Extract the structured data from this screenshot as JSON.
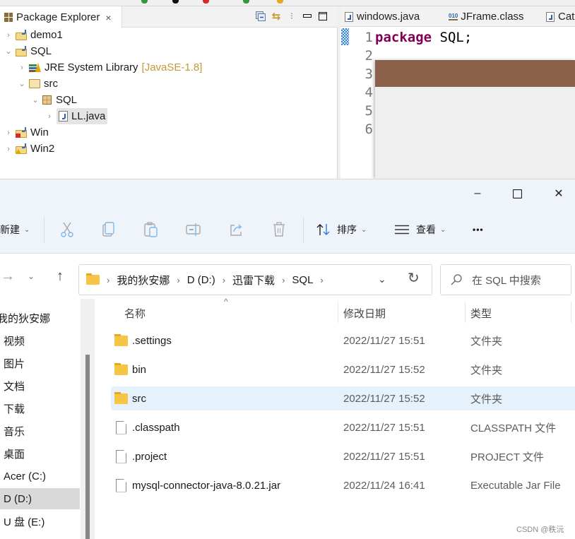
{
  "eclipse": {
    "package_explorer": {
      "tab_label": "Package Explorer",
      "close_glyph": "×",
      "tools": [
        {
          "name": "collapse-all-icon",
          "glyph": "⊟"
        },
        {
          "name": "link-with-editor-icon",
          "glyph": "⇆"
        },
        {
          "name": "view-menu-icon",
          "glyph": "⋮"
        },
        {
          "name": "minimize-icon",
          "glyph": "▭"
        },
        {
          "name": "maximize-icon",
          "glyph": "☐"
        }
      ],
      "tree": [
        {
          "label": "demo1",
          "expanded": false,
          "type": "project"
        },
        {
          "label": "SQL",
          "expanded": true,
          "type": "project"
        },
        {
          "label": "JRE System Library",
          "decoration": "[JavaSE-1.8]",
          "expanded": false,
          "type": "library"
        },
        {
          "label": "src",
          "expanded": true,
          "type": "source-folder"
        },
        {
          "label": "SQL",
          "expanded": true,
          "type": "package"
        },
        {
          "label": "LL.java",
          "expanded": false,
          "type": "java-file",
          "selected": true
        },
        {
          "label": "Win",
          "expanded": false,
          "type": "project-error"
        },
        {
          "label": "Win2",
          "expanded": false,
          "type": "project-warning"
        }
      ]
    },
    "editor": {
      "tabs": [
        {
          "label": "windows.java",
          "kind": "java"
        },
        {
          "label": "JFrame.class",
          "kind": "class"
        },
        {
          "label": "Cat",
          "kind": "java"
        }
      ],
      "line_numbers": [
        "1",
        "2",
        "3",
        "4",
        "5",
        "6"
      ],
      "code_keyword": "package",
      "code_rest": " SQL;"
    }
  },
  "explorer": {
    "window_controls": {
      "minimize": "–",
      "maximize": "☐",
      "close": "✕"
    },
    "command_bar": {
      "new_label": "新建",
      "sort_label": "排序",
      "view_label": "查看",
      "more_glyph": "•••",
      "chevron": "⌄",
      "actions": [
        "cut",
        "copy",
        "paste",
        "rename",
        "share",
        "delete"
      ]
    },
    "nav": {
      "back": "←",
      "forward": "→",
      "recent": "⌄",
      "up": "↑"
    },
    "address": {
      "breadcrumbs": [
        "我的狄安娜",
        "D (D:)",
        "迅雷下载",
        "SQL"
      ],
      "sep": "›",
      "dropdown": "⌄",
      "refresh": "↻"
    },
    "search": {
      "placeholder": "在 SQL 中搜索",
      "icon": "⚲"
    },
    "sidebar": {
      "items": [
        {
          "label": "我的狄安娜",
          "selected": false
        },
        {
          "label": "视频",
          "selected": false
        },
        {
          "label": "图片",
          "selected": false
        },
        {
          "label": "文档",
          "selected": false
        },
        {
          "label": "下载",
          "selected": false
        },
        {
          "label": "音乐",
          "selected": false
        },
        {
          "label": "桌面",
          "selected": false
        },
        {
          "label": "Acer (C:)",
          "selected": false
        },
        {
          "label": "D (D:)",
          "selected": true
        },
        {
          "label": "U 盘 (E:)",
          "selected": false
        }
      ]
    },
    "columns": {
      "name": "名称",
      "date": "修改日期",
      "type": "类型",
      "sort_caret": "^"
    },
    "files": [
      {
        "name": ".settings",
        "date": "2022/11/27 15:51",
        "type": "文件夹",
        "kind": "folder",
        "selected": false
      },
      {
        "name": "bin",
        "date": "2022/11/27 15:52",
        "type": "文件夹",
        "kind": "folder",
        "selected": false
      },
      {
        "name": "src",
        "date": "2022/11/27 15:52",
        "type": "文件夹",
        "kind": "folder",
        "selected": true
      },
      {
        "name": ".classpath",
        "date": "2022/11/27 15:51",
        "type": "CLASSPATH 文件",
        "kind": "file",
        "selected": false
      },
      {
        "name": ".project",
        "date": "2022/11/27 15:51",
        "type": "PROJECT 文件",
        "kind": "file",
        "selected": false
      },
      {
        "name": "mysql-connector-java-8.0.21.jar",
        "date": "2022/11/24 16:41",
        "type": "Executable Jar File",
        "kind": "file",
        "selected": false
      }
    ]
  },
  "watermark": "CSDN @秩沅",
  "colors": {
    "eclipse_keyword": "#7f0055",
    "overlay_title": "#8b614b",
    "explorer_chrome": "#eef4f9",
    "selected_row": "#e5f1fb"
  }
}
